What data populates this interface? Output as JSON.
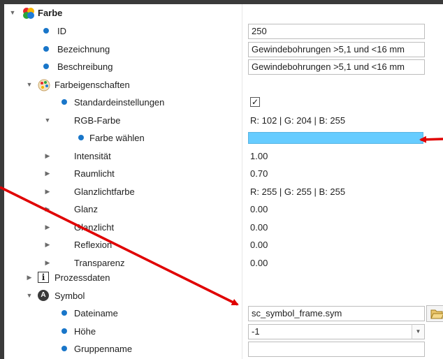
{
  "tree": {
    "farbe": {
      "label": "Farbe",
      "icon": "color-balls-icon"
    },
    "id": {
      "label": "ID",
      "value": "250"
    },
    "bezeichnung": {
      "label": "Bezeichnung",
      "value": "Gewindebohrungen >5,1 und <16 mm"
    },
    "beschreibung": {
      "label": "Beschreibung",
      "value": "Gewindebohrungen >5,1 und <16 mm"
    },
    "farbeigenschaften": {
      "label": "Farbeigenschaften",
      "icon": "palette-icon"
    },
    "standardeinstellungen": {
      "label": "Standardeinstellungen",
      "checked": true,
      "check_glyph": "✓"
    },
    "rgb_farbe": {
      "label": "RGB-Farbe",
      "value": "R: 102 | G: 204 | B: 255"
    },
    "farbe_waehlen": {
      "label": "Farbe wählen",
      "color": "#66ccff"
    },
    "intensitaet": {
      "label": "Intensität",
      "value": "1.00"
    },
    "raumlicht": {
      "label": "Raumlicht",
      "value": "0.70"
    },
    "glanzlichtfarbe": {
      "label": "Glanzlichtfarbe",
      "value": "R: 255 | G: 255 | B: 255"
    },
    "glanz": {
      "label": "Glanz",
      "value": "0.00"
    },
    "glanzlicht": {
      "label": "Glanzlicht",
      "value": "0.00"
    },
    "reflexion": {
      "label": "Reflexion",
      "value": "0.00"
    },
    "transparenz": {
      "label": "Transparenz",
      "value": "0.00"
    },
    "prozessdaten": {
      "label": "Prozessdaten",
      "icon": "info-icon",
      "icon_glyph": "i"
    },
    "symbol": {
      "label": "Symbol",
      "icon": "symbol-icon",
      "icon_glyph": "A"
    },
    "dateiname": {
      "label": "Dateiname",
      "value": "sc_symbol_frame.sym"
    },
    "hoehe": {
      "label": "Höhe",
      "value": "-1"
    },
    "gruppenname": {
      "label": "Gruppenname",
      "value": ""
    }
  },
  "colors": {
    "accent_dot": "#1976c9",
    "annotation_arrow": "#e00000",
    "selected_color": "#66ccff"
  }
}
